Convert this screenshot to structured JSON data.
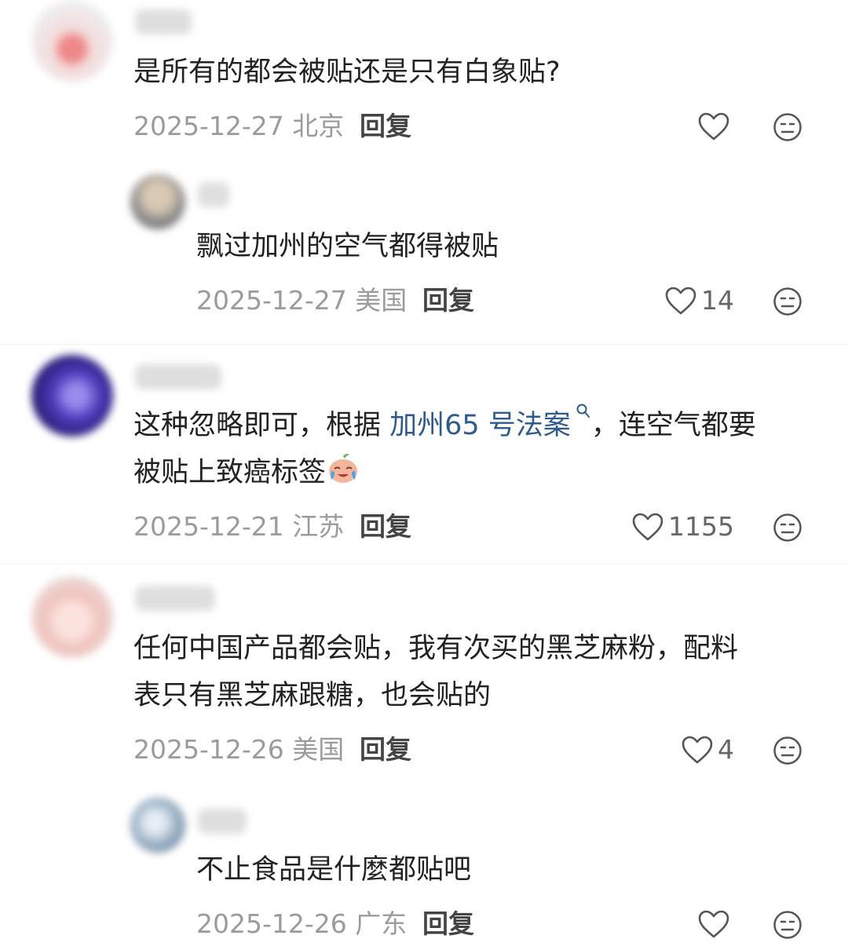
{
  "comments": [
    {
      "text": "是所有的都会被贴还是只有白象贴?",
      "date": "2025-12-27 北京",
      "reply": "回复",
      "likes": "",
      "replies": [
        {
          "text": "飘过加州的空气都得被贴",
          "date": "2025-12-27 美国",
          "reply": "回复",
          "likes": "14"
        }
      ]
    },
    {
      "text_before_link": "这种忽略即可，根据 ",
      "link_text": "加州65 号法案",
      "text_after_link": "，连空气都要",
      "text_line2": "被贴上致癌标签",
      "date": "2025-12-21 江苏",
      "reply": "回复",
      "likes": "1155"
    },
    {
      "text_line1": "任何中国产品都会贴，我有次买的黑芝麻粉，配料",
      "text_line2": "表只有黑芝麻跟糖，也会贴的",
      "date": "2025-12-26 美国",
      "reply": "回复",
      "likes": "4",
      "replies": [
        {
          "text": "不止食品是什麼都贴吧",
          "date": "2025-12-26 广东",
          "reply": "回复",
          "likes": ""
        }
      ]
    }
  ],
  "icons": {
    "like": "heart-outline-icon",
    "dislike": "neutral-face-icon",
    "link_marker": "search-link-icon",
    "emoji": "crying-laughing-emoji"
  },
  "colors": {
    "text": "#222222",
    "meta": "#9b9b9b",
    "link": "#2f5a8c"
  }
}
